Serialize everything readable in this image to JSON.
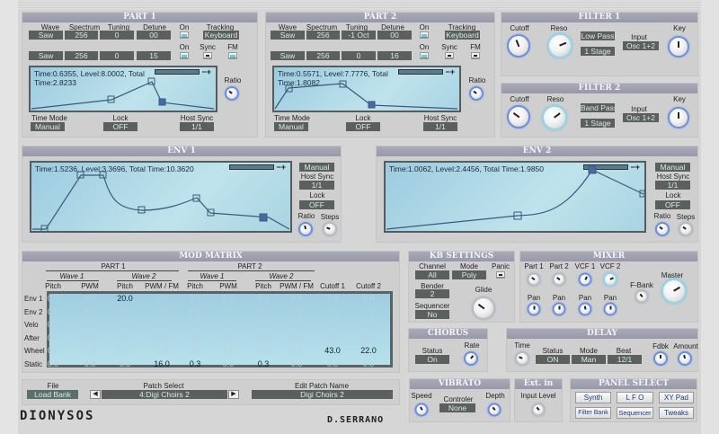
{
  "part1": {
    "title": "PART 1",
    "labels": {
      "wave": "Wave",
      "spectrum": "Spectrum",
      "tuning": "Tuning",
      "detune": "Detune",
      "on": "On",
      "tracking": "Tracking",
      "on2": "On",
      "sync": "Sync",
      "fm": "FM",
      "ratio": "Ratio",
      "time_mode": "Time Mode",
      "lock": "Lock",
      "host_sync": "Host Sync"
    },
    "osc1": {
      "wave": "Saw",
      "spectrum": "256",
      "tuning": "0",
      "detune": "00",
      "on": true
    },
    "tracking": "Keyboard",
    "osc2": {
      "wave": "Saw",
      "spectrum": "256",
      "tuning": "0",
      "detune": "15",
      "on": true
    },
    "sync": false,
    "fm": true,
    "env_text1": "Time:0.6355, Level:8.0002, Total",
    "env_text2": "Time:2.8233",
    "time_mode": "Manual",
    "lock": "OFF",
    "host_sync": "1/1"
  },
  "part2": {
    "title": "PART 2",
    "labels": {
      "wave": "Wave",
      "spectrum": "Spectrum",
      "tuning": "Tuning",
      "detune": "Detune",
      "on": "On",
      "tracking": "Tracking",
      "on2": "On",
      "sync": "Sync",
      "fm": "FM",
      "ratio": "Ratio",
      "time_mode": "Time Mode",
      "lock": "Lock",
      "host_sync": "Host Sync"
    },
    "osc1": {
      "wave": "Saw",
      "spectrum": "256",
      "tuning": "-1 Oct",
      "detune": "00",
      "on": true
    },
    "tracking": "Keyboard",
    "osc2": {
      "wave": "Saw",
      "spectrum": "256",
      "tuning": "0",
      "detune": "16",
      "on": true
    },
    "sync": false,
    "fm": false,
    "env_text1": "Time:0.5571, Level:7.7776, Total",
    "env_text2": "Time:1.8082",
    "time_mode": "Manual",
    "lock": "OFF",
    "host_sync": "1/1"
  },
  "filter1": {
    "title": "FILTER 1",
    "cutoff_label": "Cutoff",
    "reso_label": "Reso",
    "type": "Low Pass",
    "stages": "1 Stage",
    "input_label": "Input",
    "input": "Osc 1+2",
    "key_label": "Key"
  },
  "filter2": {
    "title": "FILTER 2",
    "cutoff_label": "Cutoff",
    "reso_label": "Reso",
    "type": "Band Pass",
    "stages": "1 Stage",
    "input_label": "Input",
    "input": "Osc 1+2",
    "key_label": "Key"
  },
  "env1": {
    "title": "ENV 1",
    "text": "Time:1.5236, Level:3.3696, Total Time:10.3620",
    "mode": "Manual",
    "host_sync_label": "Host Sync",
    "host_sync": "1/1",
    "lock_label": "Lock",
    "lock": "OFF",
    "ratio_label": "Ratio",
    "steps_label": "Steps"
  },
  "env2": {
    "title": "ENV 2",
    "text": "Time:1.0062, Level:2.4456, Total Time:1.9850",
    "mode": "Manual",
    "host_sync_label": "Host Sync",
    "host_sync": "1/1",
    "lock_label": "Lock",
    "lock": "OFF",
    "ratio_label": "Ratio",
    "steps_label": "Steps"
  },
  "mod_matrix": {
    "title": "MOD MATRIX",
    "part1": "PART 1",
    "part2": "PART 2",
    "wave1": "Wave 1",
    "wave2": "Wave 2",
    "columns": [
      "Pitch",
      "PWM",
      "Pitch",
      "PWM / FM",
      "Pitch",
      "PWM",
      "Pitch",
      "PWM / FM",
      "Cutoff 1",
      "Cutoff 2"
    ],
    "rows": [
      {
        "label": "Env 1",
        "values": [
          "0.0",
          "0.0",
          "20.0",
          "0.0",
          "0.0",
          "0.0",
          "0.0",
          "0.0",
          "0.0",
          "0.0"
        ]
      },
      {
        "label": "Env 2",
        "values": [
          "0.0",
          "0.0",
          "0.0",
          "0.0",
          "0.0",
          "0.0",
          "0.0",
          "0.0",
          "0.0",
          "0.0"
        ]
      },
      {
        "label": "Velo",
        "values": [
          "0.0",
          "0.0",
          "0.0",
          "0.0",
          "0.0",
          "0.0",
          "0.0",
          "0.0",
          "0.0",
          "0.0"
        ]
      },
      {
        "label": "After",
        "values": [
          "0.0",
          "0.0",
          "0.0",
          "0.0",
          "0.0",
          "0.0",
          "0.0",
          "0.0",
          "0.0",
          "0.0"
        ]
      },
      {
        "label": "Wheel",
        "values": [
          "0.0",
          "0.0",
          "0.0",
          "0.0",
          "0.0",
          "0.0",
          "0.0",
          "0.0",
          "43.0",
          "22.0"
        ]
      },
      {
        "label": "Static",
        "values": [
          "0.0",
          "0.0",
          "0.0",
          "16.0",
          "0.3",
          "0.0",
          "0.3",
          "0.0",
          "0.0",
          "0.0"
        ]
      }
    ]
  },
  "kb": {
    "title": "KB SETTINGS",
    "channel_label": "Channel",
    "channel": "All",
    "mode_label": "Mode",
    "mode": "Poly",
    "panic_label": "Panic",
    "bender_label": "Bender",
    "bender": "2",
    "glide_label": "Glide",
    "sequencer_label": "Sequencer",
    "sequencer": "No"
  },
  "mixer": {
    "title": "MIXER",
    "part1": "Part 1",
    "part2": "Part 2",
    "vcf1": "VCF 1",
    "vcf2": "VCF 2",
    "pan": "Pan",
    "fbank": "F-Bank",
    "master": "Master"
  },
  "chorus": {
    "title": "CHORUS",
    "status_label": "Status",
    "status": "On",
    "rate_label": "Rate"
  },
  "delay": {
    "title": "DELAY",
    "time_label": "Time",
    "status_label": "Status",
    "status": "ON",
    "mode_label": "Mode",
    "mode": "Man",
    "beat_label": "Beat",
    "beat": "12/1",
    "fdbk_label": "Fdbk",
    "amount_label": "Amount"
  },
  "file": {
    "file_label": "File",
    "load_bank": "Load Bank",
    "patch_select_label": "Patch Select",
    "patch": "4:Digi Choirs 2",
    "edit_name_label": "Edit Patch Name",
    "patch_name": "Digi Choirs 2",
    "prev": "◀",
    "next": "▶"
  },
  "vibrato": {
    "title": "VIBRATO",
    "speed_label": "Speed",
    "controller_label": "Controler",
    "controller": "None",
    "depth_label": "Depth"
  },
  "extin": {
    "title": "Ext. in",
    "input_level_label": "Input Level"
  },
  "panel_select": {
    "title": "PANEL SELECT",
    "buttons": [
      "Synth",
      "L F O",
      "XY Pad",
      "Filter Bank",
      "Sequencer",
      "Tweaks"
    ]
  },
  "logos": {
    "product": "DIONYSOS",
    "author": "D.SERRANO"
  },
  "knobs": {
    "p1_ratio": 0.3,
    "p2_ratio": 0.3,
    "f1_cutoff": 0.42,
    "f1_reso": 0.75,
    "f1_key": 0.5,
    "f2_cutoff": 0.3,
    "f2_reso": 0.7,
    "f2_key": 0.5,
    "e1_ratio": 0.45,
    "e1_steps": 0.25,
    "e2_ratio": 0.3,
    "e2_steps": 0.3,
    "glide": 0.3,
    "mix_p1": 0.3,
    "mix_p2": 0.3,
    "mix_vcf1": 0.6,
    "mix_vcf2": 0.75,
    "pan1": 0.5,
    "pan2": 0.5,
    "pan3": 0.45,
    "pan4": 0.5,
    "fbank": 0.35,
    "master": 0.72,
    "chorus_rate": 0.65,
    "delay_time": 0.25,
    "fdbk": 0.5,
    "amount": 0.45,
    "vib_speed": 0.4,
    "vib_depth": 0.35,
    "input_level": 0.35
  }
}
